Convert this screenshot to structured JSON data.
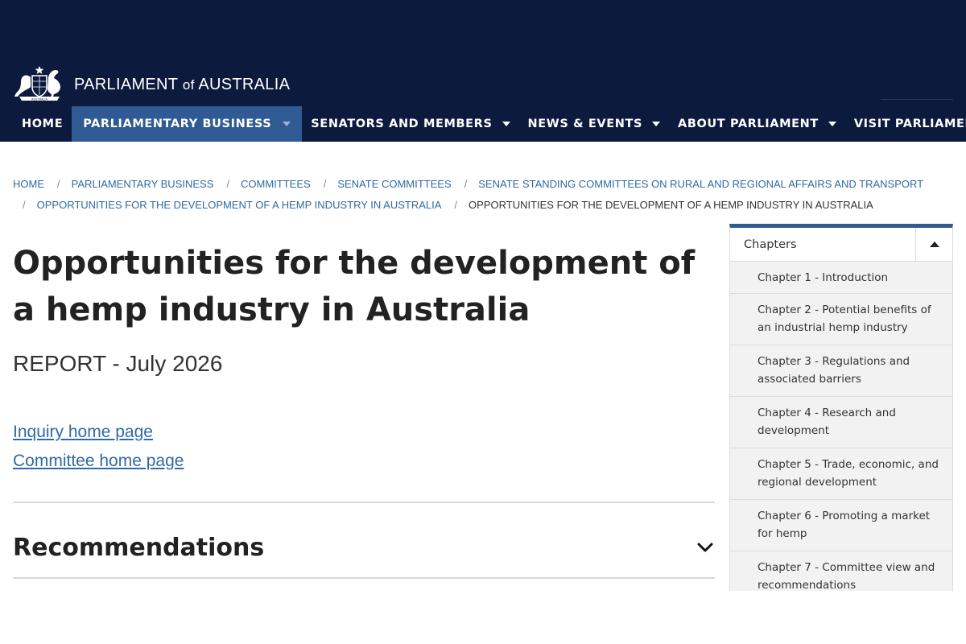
{
  "site": {
    "logo_text_a": "PARLIAMENT",
    "logo_text_of": "of",
    "logo_text_b": "AUSTRALIA",
    "crest_text": "AUSTRALIA"
  },
  "nav": {
    "items": [
      {
        "label": "HOME",
        "dropdown": false,
        "active": false
      },
      {
        "label": "PARLIAMENTARY BUSINESS",
        "dropdown": true,
        "active": true
      },
      {
        "label": "SENATORS AND MEMBERS",
        "dropdown": true,
        "active": false
      },
      {
        "label": "NEWS & EVENTS",
        "dropdown": true,
        "active": false
      },
      {
        "label": "ABOUT PARLIAMENT",
        "dropdown": true,
        "active": false
      },
      {
        "label": "VISIT PARLIAMENT",
        "dropdown": true,
        "active": false
      }
    ]
  },
  "breadcrumb": {
    "items": [
      "HOME",
      "PARLIAMENTARY BUSINESS",
      "COMMITTEES",
      "SENATE COMMITTEES",
      "SENATE STANDING COMMITTEES ON RURAL AND REGIONAL AFFAIRS AND TRANSPORT",
      "OPPORTUNITIES FOR THE DEVELOPMENT OF A HEMP INDUSTRY IN AUSTRALIA",
      "OPPORTUNITIES FOR THE DEVELOPMENT OF A HEMP INDUSTRY IN AUSTRALIA"
    ],
    "separator": "/"
  },
  "main": {
    "title": "Opportunities for the development of a hemp industry in Australia",
    "subtitle": "REPORT - July 2026",
    "links": [
      "Inquiry home page",
      "Committee home page"
    ],
    "section_title": "Recommendations"
  },
  "sidebar": {
    "heading": "Chapters",
    "items": [
      "Chapter 1 - Introduction",
      "Chapter 2 - Potential benefits of an industrial hemp industry",
      "Chapter 3 - Regulations and associated barriers",
      "Chapter 4 - Research and development",
      "Chapter 5 - Trade, economic, and regional development",
      "Chapter 6 - Promoting a market for hemp",
      "Chapter 7 - Committee view and recommendations"
    ]
  },
  "colors": {
    "header_bg": "#0c1a3e",
    "nav_active": "#2f5a93",
    "link": "#2f6aa3"
  }
}
